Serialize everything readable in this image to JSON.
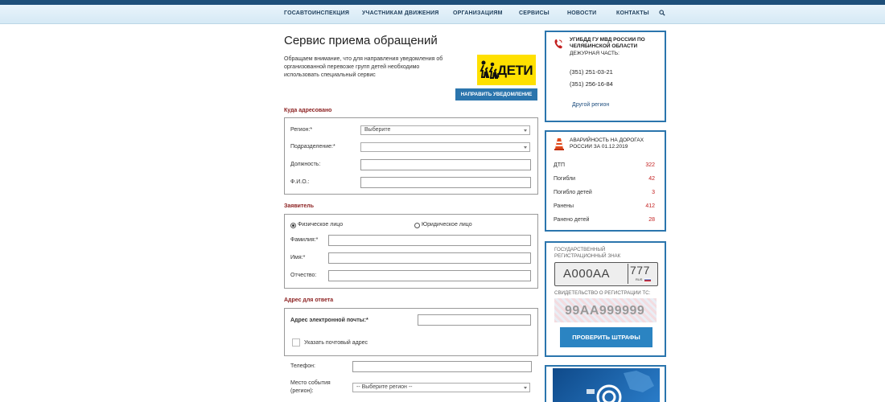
{
  "nav": {
    "items": [
      "ГОСАВТОИНСПЕКЦИЯ",
      "УЧАСТНИКАМ ДВИЖЕНИЯ",
      "ОРГАНИЗАЦИЯМ",
      "СЕРВИСЫ",
      "НОВОСТИ",
      "КОНТАКТЫ"
    ]
  },
  "page": {
    "title": "Сервис приема обращений",
    "intro": "Обращаем внимание, что для направления уведомления об организованной перевозке групп детей необходимо использовать специальный сервис",
    "deti_label": "ДЕТИ",
    "notify_button": "НАПРАВИТЬ УВЕДОМЛЕНИЕ"
  },
  "addressed": {
    "section_title": "Куда адресовано",
    "region_label": "Регион:*",
    "region_value": "Выберите",
    "division_label": "Подразделение:*",
    "division_value": "",
    "position_label": "Должность:",
    "fio_label": "Ф.И.О.:"
  },
  "applicant": {
    "section_title": "Заявитель",
    "individual_label": "Физическое лицо",
    "legal_label": "Юридическое лицо",
    "surname_label": "Фамилия:*",
    "name_label": "Имя:*",
    "patronymic_label": "Отчество:"
  },
  "reply": {
    "section_title": "Адрес для ответа",
    "email_label": "Адрес электронной почты:*",
    "postal_label": "Указать почтовый адрес",
    "phone_label": "Телефон:",
    "event_place_label": "Место события (регион):",
    "event_place_value": "-- Выберите регион --"
  },
  "contact_panel": {
    "org": "УГИБДД ГУ МВД РОССИИ ПО ЧЕЛЯБИНСКОЙ ОБЛАСТИ",
    "duty": "ДЕЖУРНАЯ ЧАСТЬ:",
    "phone1": "(351) 251-03-21",
    "phone2": "(351) 256-16-84",
    "other_region": "Другой регион"
  },
  "accidents": {
    "title": "АВАРИЙНОСТЬ НА ДОРОГАХ РОССИИ ЗА 01.12.2019",
    "rows": [
      {
        "label": "ДТП",
        "value": "322"
      },
      {
        "label": "Погибли",
        "value": "42"
      },
      {
        "label": "Погибло детей",
        "value": "3"
      },
      {
        "label": "Ранены",
        "value": "412"
      },
      {
        "label": "Ранено детей",
        "value": "28"
      }
    ],
    "accent_color": "#c32020"
  },
  "fines": {
    "plate_caption": "ГОСУДАРСТВЕННЫЙ РЕГИСТРАЦИОННЫЙ ЗНАК",
    "plate_number": "А000АА",
    "plate_region": "777",
    "plate_country": "RUS",
    "cert_caption": "СВИДЕТЕЛЬСТВО О РЕГИСТРАЦИИ ТС:",
    "cert_number": "99АА999999",
    "button": "ПРОВЕРИТЬ ШТРАФЫ"
  },
  "colors": {
    "brand_blue": "#2b75ad",
    "nav_dark": "#1e4f7a",
    "section_red": "#8b1f1f",
    "deti_yellow": "#ffe000"
  }
}
